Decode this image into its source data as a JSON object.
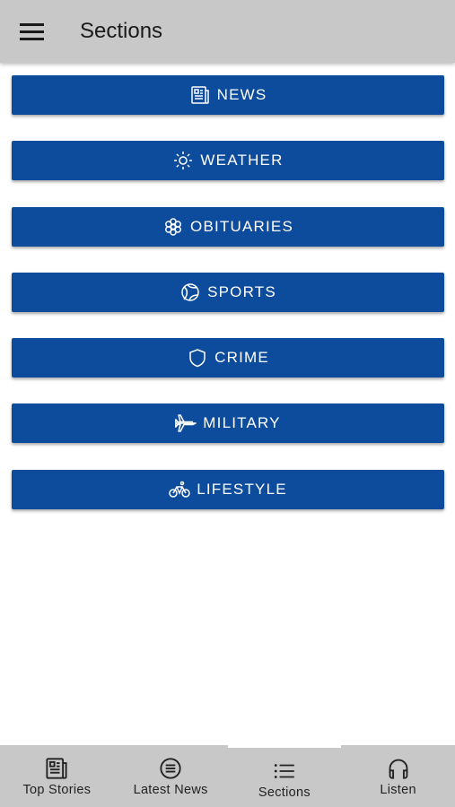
{
  "app_bar": {
    "title": "Sections",
    "menu_icon": "hamburger-menu-icon"
  },
  "sections": [
    {
      "label": "NEWS",
      "icon": "newspaper-icon"
    },
    {
      "label": "WEATHER",
      "icon": "sun-icon"
    },
    {
      "label": "OBITUARIES",
      "icon": "flower-icon"
    },
    {
      "label": "SPORTS",
      "icon": "ball-icon"
    },
    {
      "label": "CRIME",
      "icon": "shield-icon"
    },
    {
      "label": "MILITARY",
      "icon": "jet-icon"
    },
    {
      "label": "LIFESTYLE",
      "icon": "bicycle-icon"
    }
  ],
  "bottom_nav": [
    {
      "label": "Top Stories",
      "icon": "newspaper-icon"
    },
    {
      "label": "Latest News",
      "icon": "list-circle-icon"
    },
    {
      "label": "Sections",
      "icon": "list-icon",
      "active": true
    },
    {
      "label": "Listen",
      "icon": "headphones-icon"
    }
  ],
  "colors": {
    "primary": "#0d4c9c",
    "app_bar": "#c8c8c8",
    "background": "#ffffff",
    "text": "#1a1a1a"
  }
}
